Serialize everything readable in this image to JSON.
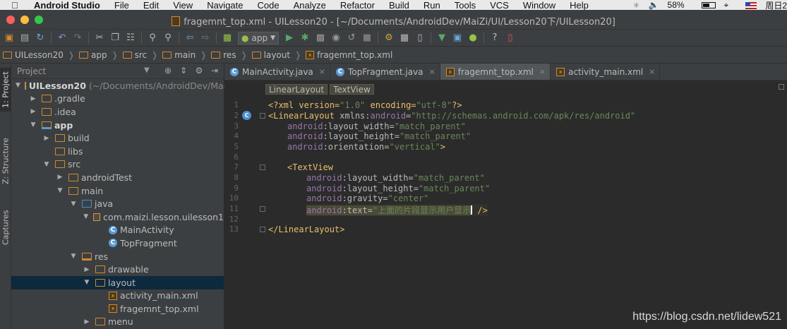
{
  "menubar": {
    "app": "Android Studio",
    "items": [
      "File",
      "Edit",
      "View",
      "Navigate",
      "Code",
      "Analyze",
      "Refactor",
      "Build",
      "Run",
      "Tools",
      "VCS",
      "Window",
      "Help"
    ],
    "battery": "58%",
    "battery_level": 0.58,
    "clock": "周日2"
  },
  "window": {
    "title": "fragemnt_top.xml - UILesson20 - [~/Documents/AndroidDev/MaiZi/UI/Lesson20下/UILesson20]"
  },
  "toolbar": {
    "run_config": "app",
    "icons": [
      "folder-icon",
      "save-icon",
      "sync-icon",
      "undo-icon",
      "redo-icon",
      "cut-icon",
      "copy-icon",
      "paste-icon",
      "find-icon",
      "replace-icon",
      "back-icon",
      "forward-icon",
      "build-icon",
      "android-icon",
      "run-icon",
      "debug-icon",
      "attach-icon",
      "coverage-icon",
      "stop-icon",
      "settings-icon",
      "project-structure-icon",
      "avd-icon",
      "sdk-icon",
      "android-device-icon",
      "help-icon",
      "monitor-icon"
    ]
  },
  "breadcrumbs": [
    "UILesson20",
    "app",
    "src",
    "main",
    "res",
    "layout",
    "fragemnt_top.xml"
  ],
  "left_strip": {
    "project": "1: Project",
    "structure": "Z: Structure",
    "captures": "Captures"
  },
  "project_panel": {
    "header": "Project",
    "tree": [
      {
        "label": "UILesson20",
        "suffix": "(~/Documents/AndroidDev/MaiZi",
        "depth": 0,
        "expanded": true,
        "icon": "module"
      },
      {
        "label": ".gradle",
        "depth": 1,
        "expanded": false,
        "icon": "folder"
      },
      {
        "label": ".idea",
        "depth": 1,
        "expanded": false,
        "icon": "folder"
      },
      {
        "label": "app",
        "depth": 1,
        "expanded": true,
        "icon": "module",
        "bold": true
      },
      {
        "label": "build",
        "depth": 2,
        "expanded": false,
        "icon": "folder"
      },
      {
        "label": "libs",
        "depth": 2,
        "expanded": null,
        "icon": "folder"
      },
      {
        "label": "src",
        "depth": 2,
        "expanded": true,
        "icon": "folder"
      },
      {
        "label": "androidTest",
        "depth": 3,
        "expanded": false,
        "icon": "folder"
      },
      {
        "label": "main",
        "depth": 3,
        "expanded": true,
        "icon": "folder"
      },
      {
        "label": "java",
        "depth": 4,
        "expanded": true,
        "icon": "folder-blue"
      },
      {
        "label": "com.maizi.lesson.uilesson1",
        "depth": 5,
        "expanded": true,
        "icon": "package"
      },
      {
        "label": "MainActivity",
        "depth": 6,
        "expanded": null,
        "icon": "class"
      },
      {
        "label": "TopFragment",
        "depth": 6,
        "expanded": null,
        "icon": "class"
      },
      {
        "label": "res",
        "depth": 4,
        "expanded": true,
        "icon": "folder-res"
      },
      {
        "label": "drawable",
        "depth": 5,
        "expanded": false,
        "icon": "folder"
      },
      {
        "label": "layout",
        "depth": 5,
        "expanded": true,
        "icon": "folder",
        "selected": true
      },
      {
        "label": "activity_main.xml",
        "depth": 6,
        "expanded": null,
        "icon": "xml"
      },
      {
        "label": "fragemnt_top.xml",
        "depth": 6,
        "expanded": null,
        "icon": "xml"
      },
      {
        "label": "menu",
        "depth": 5,
        "expanded": false,
        "icon": "folder"
      }
    ]
  },
  "editor": {
    "tabs": [
      {
        "label": "MainActivity.java",
        "icon": "class",
        "active": false
      },
      {
        "label": "TopFragment.java",
        "icon": "class",
        "active": false
      },
      {
        "label": "fragemnt_top.xml",
        "icon": "xml",
        "active": true
      },
      {
        "label": "activity_main.xml",
        "icon": "xml",
        "active": false
      }
    ],
    "xml_path": [
      "LinearLayout",
      "TextView"
    ],
    "lines": [
      "1",
      "2",
      "3",
      "4",
      "5",
      "6",
      "7",
      "8",
      "9",
      "10",
      "11",
      "12",
      "13"
    ],
    "code": {
      "l1_a": "<?xml version=",
      "l1_b": "\"1.0\"",
      "l1_c": " encoding=",
      "l1_d": "\"utf-8\"",
      "l1_e": "?>",
      "l2_tag": "<LinearLayout",
      "l2_attr": " xmlns:",
      "l2_ns": "android",
      "l2_eq": "=",
      "l2_val": "\"http://schemas.android.com/apk/res/android\"",
      "l3_ns": "android",
      "l3_attr": ":layout_width=",
      "l3_val": "\"match_parent\"",
      "l4_ns": "android",
      "l4_attr": ":layout_height=",
      "l4_val": "\"match_parent\"",
      "l5_ns": "android",
      "l5_attr": ":orientation=",
      "l5_val": "\"vertical\"",
      "l5_end": ">",
      "l7_tag": "<TextView",
      "l8_ns": "android",
      "l8_attr": ":layout_width=",
      "l8_val": "\"match_parent\"",
      "l9_ns": "android",
      "l9_attr": ":layout_height=",
      "l9_val": "\"match_parent\"",
      "l10_ns": "android",
      "l10_attr": ":gravity=",
      "l10_val": "\"center\"",
      "l11_ns": "android",
      "l11_attr": ":text=",
      "l11_val": "\"上面的片段显示用户显示",
      "l11_end": " />",
      "l13_tag": "</LinearLayout>"
    }
  },
  "watermark": "https://blog.csdn.net/lidew521"
}
